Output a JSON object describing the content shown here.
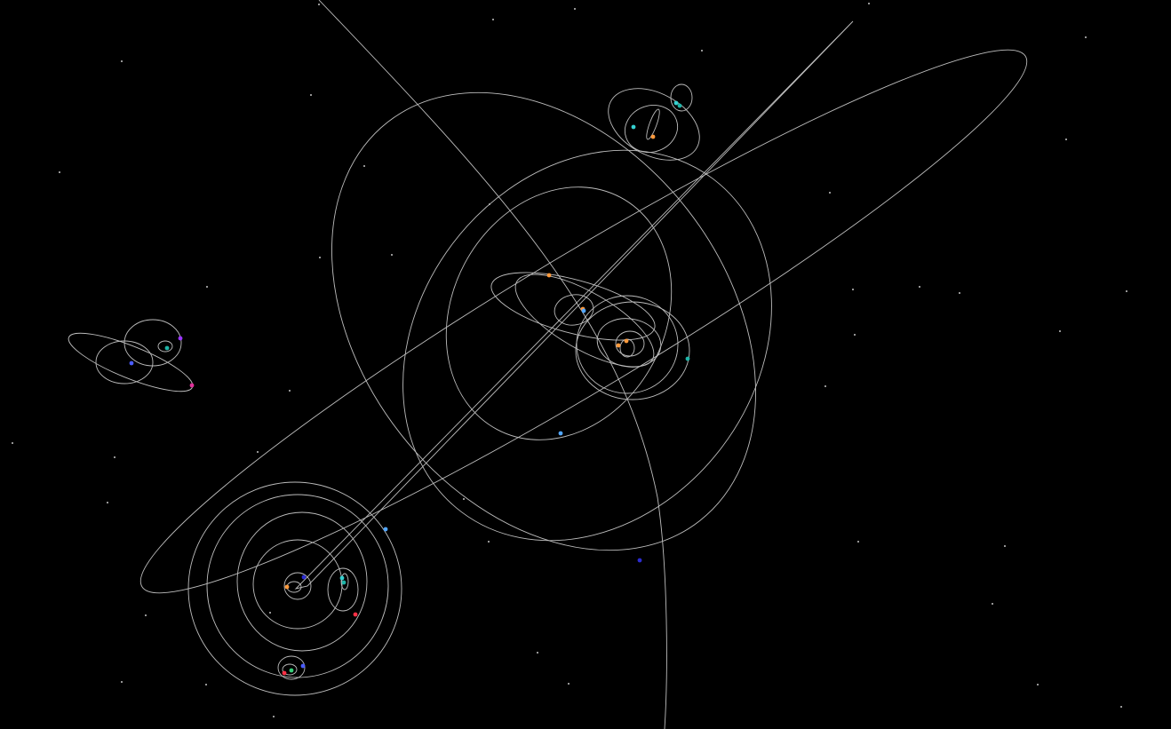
{
  "scene": {
    "background": "#000000",
    "orbit_color": "#bdbdbd",
    "star_color": "#ffffff",
    "body_colors": {
      "orange": "#ff9a3c",
      "cyan": "#35d0d0",
      "teal": "#1fb5a8",
      "light_blue": "#52a7ff",
      "blue": "#4a5cff",
      "deep_blue": "#2c2cd0",
      "purple": "#9a35ff",
      "red": "#ff3045",
      "magenta": "#e0309a",
      "green": "#37d07a",
      "white": "#ffffff"
    }
  }
}
